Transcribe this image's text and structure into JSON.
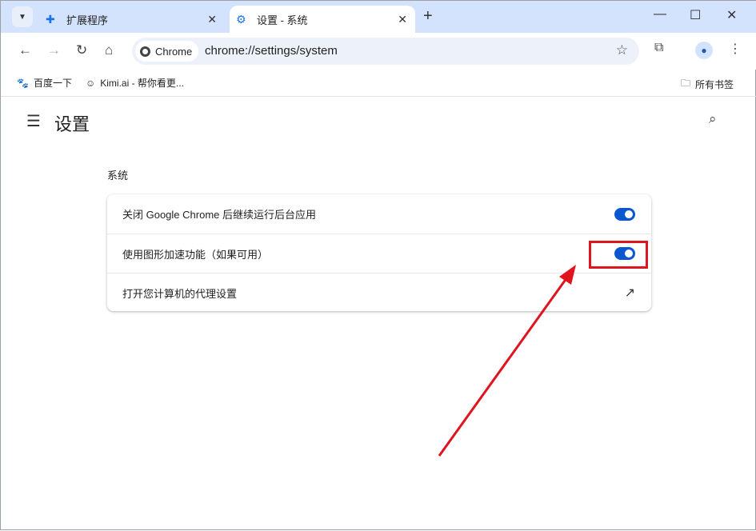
{
  "tabs": [
    {
      "label": "扩展程序",
      "icon": "puzzle-icon"
    },
    {
      "label": "设置 - 系统",
      "icon": "gear-icon",
      "active": true
    }
  ],
  "address": {
    "chip": "Chrome",
    "url": "chrome://settings/system"
  },
  "bookmarks": [
    {
      "label": "百度一下"
    },
    {
      "label": "Kimi.ai - 帮你看更..."
    }
  ],
  "all_bookmarks": "所有书签",
  "page": {
    "title": "设置",
    "section": "系统",
    "rows": [
      {
        "label": "关闭 Google Chrome 后继续运行后台应用",
        "type": "toggle",
        "on": true
      },
      {
        "label": "使用图形加速功能（如果可用）",
        "type": "toggle",
        "on": true
      },
      {
        "label": "打开您计算机的代理设置",
        "type": "external-link"
      }
    ]
  },
  "annotation": {
    "color": "#e0141e",
    "highlight": "hardware-acceleration-toggle"
  },
  "colors": {
    "accent": "#0b57d0",
    "tabbar": "#d3e3fd"
  }
}
